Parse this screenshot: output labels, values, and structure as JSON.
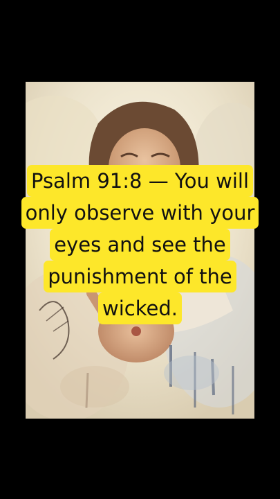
{
  "caption": {
    "lines": [
      "Psalm 91:8 — You will",
      "only observe with your",
      "eyes and see the",
      "punishment of the",
      "wicked."
    ]
  },
  "colors": {
    "background": "#000000",
    "caption_highlight": "#fde72a",
    "caption_text": "#111111"
  },
  "image": {
    "subject": "watercolor-figure"
  }
}
